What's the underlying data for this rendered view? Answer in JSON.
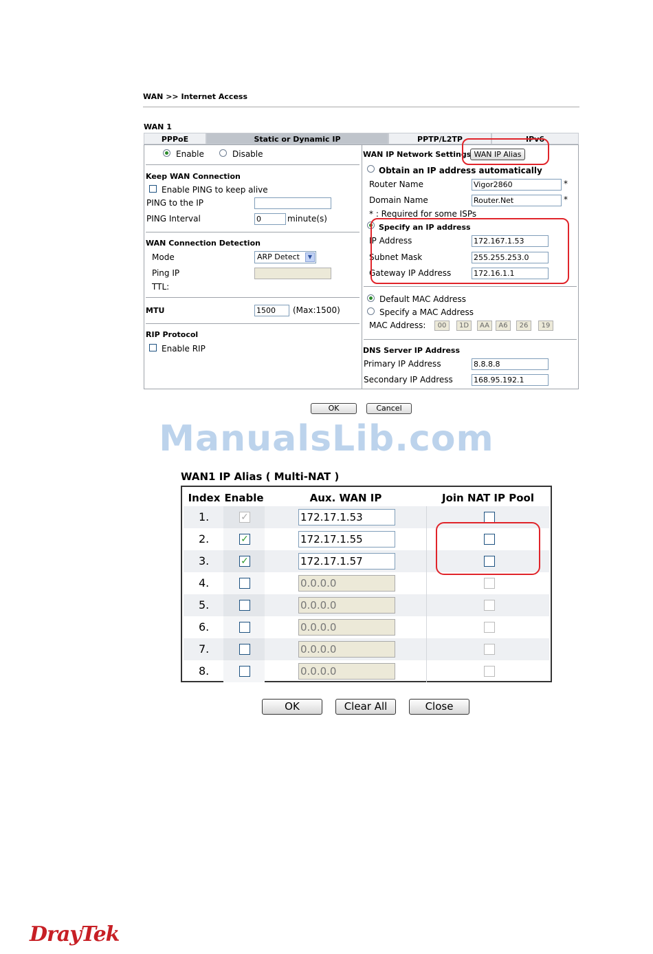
{
  "breadcrumb": "WAN >> Internet Access",
  "wan_label": "WAN 1",
  "tabs": [
    "PPPoE",
    "Static or Dynamic IP",
    "PPTP/L2TP",
    "IPv6"
  ],
  "left": {
    "enable": "Enable",
    "disable": "Disable",
    "keep_wan_title": "Keep WAN Connection",
    "enable_ping": "Enable PING to keep alive",
    "ping_ip_label": "PING to the IP",
    "ping_interval_label": "PING Interval",
    "ping_interval_value": "0",
    "ping_interval_unit": "minute(s)",
    "detection_title": "WAN Connection Detection",
    "mode_label": "Mode",
    "mode_value": "ARP Detect",
    "ping_ip2_label": "Ping IP",
    "ttl_label": "TTL:",
    "mtu_label": "MTU",
    "mtu_value": "1500",
    "mtu_max": "(Max:1500)",
    "rip_title": "RIP Protocol",
    "enable_rip": "Enable RIP"
  },
  "right": {
    "network_title": "WAN IP Network Settings",
    "alias_button": "WAN IP Alias",
    "obtain_auto": "Obtain an IP address automatically",
    "router_name_label": "Router Name",
    "router_name_value": "Vigor2860",
    "domain_name_label": "Domain Name",
    "domain_name_value": "Router.Net",
    "required_star": "*",
    "required_note": "* : Required for some ISPs",
    "specify_ip": "Specify an IP address",
    "ip_label": "IP Address",
    "ip_value": "172.167.1.53",
    "mask_label": "Subnet Mask",
    "mask_value": "255.255.253.0",
    "gw_label": "Gateway IP Address",
    "gw_value": "172.16.1.1",
    "default_mac": "Default MAC Address",
    "specify_mac": "Specify a MAC Address",
    "mac_label": "MAC Address:",
    "mac": [
      "00",
      "1D",
      "AA",
      "A6",
      "26",
      "19"
    ],
    "dns_title": "DNS Server IP Address",
    "primary_label": "Primary IP Address",
    "primary_value": "8.8.8.8",
    "secondary_label": "Secondary IP Address",
    "secondary_value": "168.95.192.1"
  },
  "buttons": {
    "ok": "OK",
    "cancel": "Cancel"
  },
  "watermark": "ManualsLib.com",
  "alias": {
    "title": "WAN1 IP Alias ( Multi-NAT )",
    "headers": [
      "Index",
      "Enable",
      "Aux. WAN IP",
      "Join NAT IP Pool"
    ],
    "rows": [
      {
        "index": "1.",
        "enabled": true,
        "enable_disabled": true,
        "ip": "172.17.1.53",
        "ip_disabled": false,
        "pool_disabled": false
      },
      {
        "index": "2.",
        "enabled": true,
        "enable_disabled": false,
        "ip": "172.17.1.55",
        "ip_disabled": false,
        "pool_disabled": false
      },
      {
        "index": "3.",
        "enabled": true,
        "enable_disabled": false,
        "ip": "172.17.1.57",
        "ip_disabled": false,
        "pool_disabled": false
      },
      {
        "index": "4.",
        "enabled": false,
        "enable_disabled": false,
        "ip": "0.0.0.0",
        "ip_disabled": true,
        "pool_disabled": true
      },
      {
        "index": "5.",
        "enabled": false,
        "enable_disabled": false,
        "ip": "0.0.0.0",
        "ip_disabled": true,
        "pool_disabled": true
      },
      {
        "index": "6.",
        "enabled": false,
        "enable_disabled": false,
        "ip": "0.0.0.0",
        "ip_disabled": true,
        "pool_disabled": true
      },
      {
        "index": "7.",
        "enabled": false,
        "enable_disabled": false,
        "ip": "0.0.0.0",
        "ip_disabled": true,
        "pool_disabled": true
      },
      {
        "index": "8.",
        "enabled": false,
        "enable_disabled": false,
        "ip": "0.0.0.0",
        "ip_disabled": true,
        "pool_disabled": true
      }
    ],
    "buttons": {
      "ok": "OK",
      "clear_all": "Clear All",
      "close": "Close"
    }
  },
  "logo": "DrayTek",
  "colors": {
    "highlight": "#e0242a",
    "check": "#2f9a2f",
    "logo": "#c71f25"
  }
}
